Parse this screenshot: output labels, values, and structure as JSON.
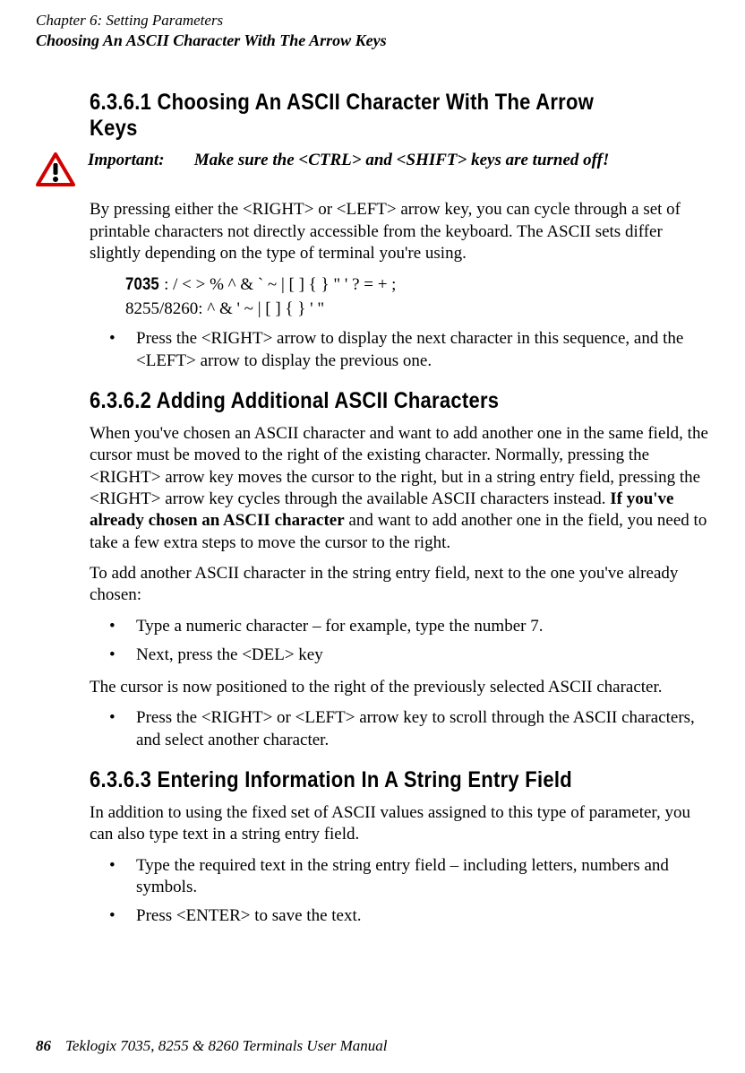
{
  "header": {
    "chapter": "Chapter 6: Setting Parameters",
    "subtitle": "Choosing An ASCII Character With The Arrow Keys"
  },
  "sections": {
    "s1": {
      "heading": "6.3.6.1 Choosing An ASCII Character With The Arrow Keys",
      "important_label": "Important:",
      "important_text": "Make sure the <CTRL> and  <SHIFT>  keys are turned off!",
      "para1": "By pressing either the <RIGHT> or <LEFT> arrow key, you can cycle through a set of printable characters not directly accessible from the keyboard. The ASCII sets differ slightly depending on the type of terminal you're using.",
      "ascii_lead": "7035",
      "ascii_7035": ": / < > % ^ & ` ~ | [ ] { } \" ' ? = + ;",
      "ascii_8255": "8255/8260: ^ & ' ~ | [ ] { } ' \"",
      "bullet1": "Press the <RIGHT> arrow to display the next character in this sequence, and the <LEFT> arrow to display the previous one."
    },
    "s2": {
      "heading": "6.3.6.2 Adding Additional ASCII Characters",
      "para1_pre": "When you've chosen an ASCII character and want to add another one in the same field, the cursor must be moved to the right of the existing character. Normally, pressing the <RIGHT> arrow key moves the cursor to the right, but in a string entry field, pressing the <RIGHT> arrow key cycles through the available ASCII characters instead. ",
      "para1_bold": "If you've already chosen an ASCII character",
      "para1_post": " and want to add another one in the field, you need to take a few extra steps to move the cursor to the right.",
      "para2": "To add another ASCII character in the string entry field, next to the one you've already chosen:",
      "bullet1": "Type a numeric character – for example, type the number 7.",
      "bullet2": "Next, press the <DEL> key",
      "para3": "The cursor is now positioned to the right of the previously selected ASCII character.",
      "bullet3": "Press the <RIGHT> or <LEFT> arrow key to scroll through the ASCII characters, and select another character."
    },
    "s3": {
      "heading": "6.3.6.3 Entering Information In A String Entry Field",
      "para1": "In addition to using the fixed set of ASCII values assigned to this type of parameter, you can also type text in a string entry field.",
      "bullet1": "Type the required text in the string entry field – including letters, numbers and symbols.",
      "bullet2": "Press <ENTER> to save the text."
    }
  },
  "footer": {
    "page_number": "86",
    "manual_title": "Teklogix 7035, 8255 & 8260 Terminals User Manual"
  }
}
